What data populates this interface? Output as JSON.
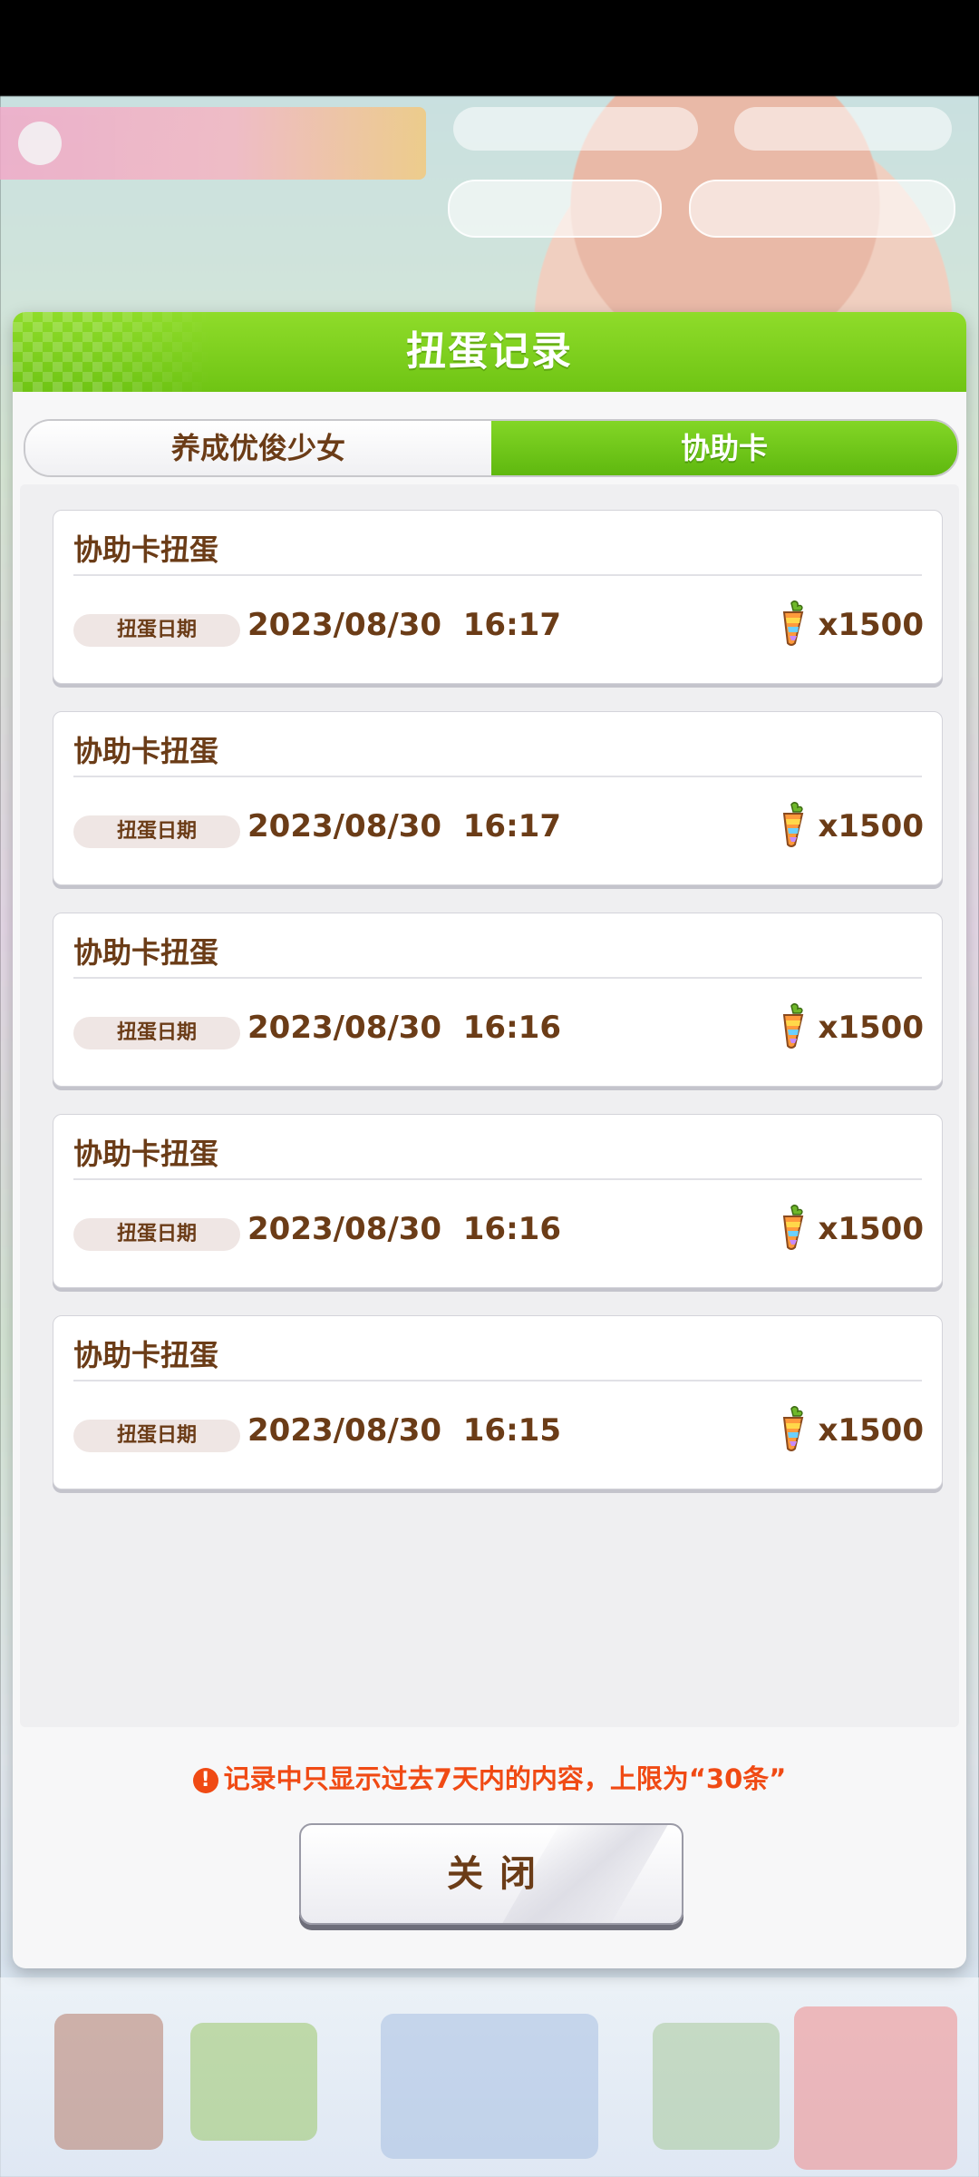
{
  "dialog": {
    "title": "扭蛋记录",
    "tabs": [
      {
        "label": "养成优俊少女",
        "active": false
      },
      {
        "label": "协助卡",
        "active": true
      }
    ],
    "records": [
      {
        "title": "协助卡扭蛋",
        "date_label": "扭蛋日期",
        "datetime": "2023/08/30  16:17",
        "amount": "x1500",
        "currency_icon": "carrot-icon"
      },
      {
        "title": "协助卡扭蛋",
        "date_label": "扭蛋日期",
        "datetime": "2023/08/30  16:17",
        "amount": "x1500",
        "currency_icon": "carrot-icon"
      },
      {
        "title": "协助卡扭蛋",
        "date_label": "扭蛋日期",
        "datetime": "2023/08/30  16:16",
        "amount": "x1500",
        "currency_icon": "carrot-icon"
      },
      {
        "title": "协助卡扭蛋",
        "date_label": "扭蛋日期",
        "datetime": "2023/08/30  16:16",
        "amount": "x1500",
        "currency_icon": "carrot-icon"
      },
      {
        "title": "协助卡扭蛋",
        "date_label": "扭蛋日期",
        "datetime": "2023/08/30  16:15",
        "amount": "x1500",
        "currency_icon": "carrot-icon"
      }
    ],
    "notice": "记录中只显示过去7天内的内容，上限为“30条”",
    "close_label": "关闭"
  },
  "colors": {
    "header_green": "#6fc414",
    "text_brown": "#6b3c17",
    "notice_red": "#f04a14"
  }
}
